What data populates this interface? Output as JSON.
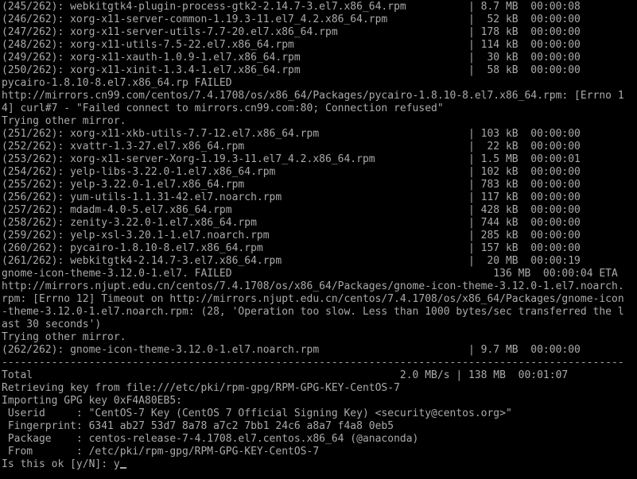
{
  "terminal": {
    "lines": [
      "(245/262): webkitgtk4-plugin-process-gtk2-2.14.7-3.el7.x86_64.rpm          | 8.7 MB  00:00:08",
      "(246/262): xorg-x11-server-common-1.19.3-11.el7_4.2.x86_64.rpm             |  52 kB  00:00:00",
      "(247/262): xorg-x11-server-utils-7.7-20.el7.x86_64.rpm                     | 178 kB  00:00:00",
      "(248/262): xorg-x11-utils-7.5-22.el7.x86_64.rpm                            | 114 kB  00:00:00",
      "(249/262): xorg-x11-xauth-1.0.9-1.el7.x86_64.rpm                           |  30 kB  00:00:00",
      "(250/262): xorg-x11-xinit-1.3.4-1.el7.x86_64.rpm                           |  58 kB  00:00:00",
      "pycairo-1.8.10-8.el7.x86_64.rp FAILED",
      "http://mirrors.cn99.com/centos/7.4.1708/os/x86_64/Packages/pycairo-1.8.10-8.el7.x86_64.rpm: [Errno 1",
      "4] curl#7 - \"Failed connect to mirrors.cn99.com:80; Connection refused\"",
      "Trying other mirror.",
      "(251/262): xorg-x11-xkb-utils-7.7-12.el7.x86_64.rpm                        | 103 kB  00:00:00",
      "(252/262): xvattr-1.3-27.el7.x86_64.rpm                                    |  22 kB  00:00:00",
      "(253/262): xorg-x11-server-Xorg-1.19.3-11.el7_4.2.x86_64.rpm               | 1.5 MB  00:00:01",
      "(254/262): yelp-libs-3.22.0-1.el7.x86_64.rpm                               | 102 kB  00:00:00",
      "(255/262): yelp-3.22.0-1.el7.x86_64.rpm                                    | 783 kB  00:00:00",
      "(256/262): yum-utils-1.1.31-42.el7.noarch.rpm                              | 117 kB  00:00:00",
      "(257/262): mdadm-4.0-5.el7.x86_64.rpm                                      | 428 kB  00:00:00",
      "(258/262): zenity-3.22.0-1.el7.x86_64.rpm                                  | 744 kB  00:00:00",
      "(259/262): yelp-xsl-3.20.1-1.el7.noarch.rpm                                | 285 kB  00:00:00",
      "(260/262): pycairo-1.8.10-8.el7.x86_64.rpm                                 | 157 kB  00:00:00",
      "(261/262): webkitgtk4-2.14.7-3.el7.x86_64.rpm                              |  20 MB  00:00:19",
      "gnome-icon-theme-3.12.0-1.el7. FAILED                                          136 MB  00:00:04 ETA",
      "http://mirrors.njupt.edu.cn/centos/7.4.1708/os/x86_64/Packages/gnome-icon-theme-3.12.0-1.el7.noarch.",
      "rpm: [Errno 12] Timeout on http://mirrors.njupt.edu.cn/centos/7.4.1708/os/x86_64/Packages/gnome-icon",
      "-theme-3.12.0-1.el7.noarch.rpm: (28, 'Operation too slow. Less than 1000 bytes/sec transferred the l",
      "ast 30 seconds')",
      "Trying other mirror.",
      "(262/262): gnome-icon-theme-3.12.0-1.el7.noarch.rpm                        | 9.7 MB  00:00:00",
      "----------------------------------------------------------------------------------------------------",
      "Total                                                           2.0 MB/s | 138 MB  00:01:07",
      "Retrieving key from file:///etc/pki/rpm-gpg/RPM-GPG-KEY-CentOS-7",
      "Importing GPG key 0xF4A80EB5:",
      " Userid     : \"CentOS-7 Key (CentOS 7 Official Signing Key) <security@centos.org>\"",
      " Fingerprint: 6341 ab27 53d7 8a78 a7c2 7bb1 24c6 a8a7 f4a8 0eb5",
      " Package    : centos-release-7-4.1708.el7.centos.x86_64 (@anaconda)",
      " From       : /etc/pki/rpm-gpg/RPM-GPG-KEY-CentOS-7"
    ],
    "prompt": "Is this ok [y/N]: ",
    "input_value": "y",
    "colors": {
      "background": "#000000",
      "foreground": "#aaaaaa"
    }
  }
}
